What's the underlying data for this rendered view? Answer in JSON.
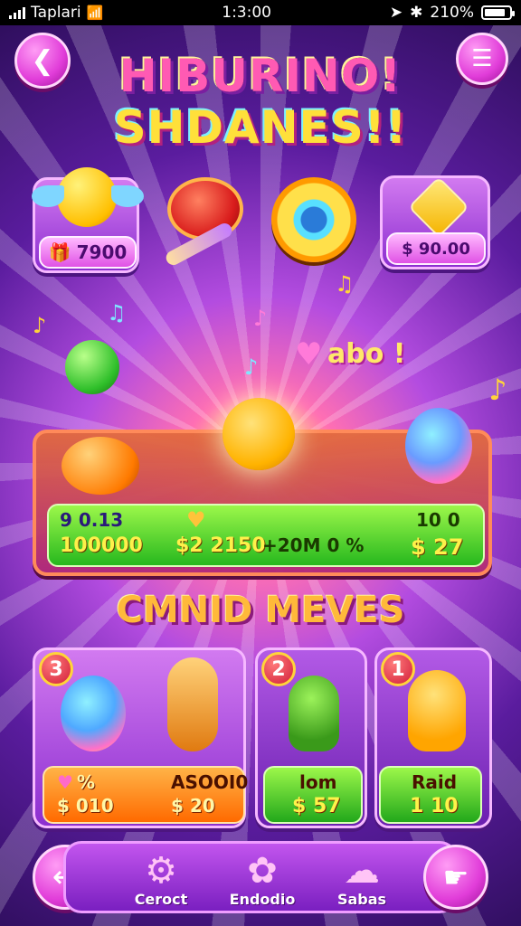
{
  "status_bar": {
    "carrier": "Taplari",
    "time": "1:3:00",
    "battery": "210%"
  },
  "header": {
    "back_icon": "back-arrow-icon",
    "menu_icon": "hamburger-menu-icon"
  },
  "title": {
    "line1": "HIBURINO!",
    "line2": "SHDANES!!"
  },
  "top_items": [
    {
      "icon": "emoji-wings-icon",
      "price": "7900"
    },
    {
      "icon": "drum-icon"
    },
    {
      "icon": "vinyl-record-icon"
    },
    {
      "icon": "music-note-diamond-icon",
      "price": "$ 90.00"
    }
  ],
  "floating_text": "abo !",
  "center_panel": {
    "stat_a": "9 0.13",
    "stat_b": "100000",
    "stat_c": "$2 2150",
    "stat_d": "+20M 0 %",
    "stat_e": "10 0",
    "stat_f": "$ 27"
  },
  "section_title": "CMNID MEVES",
  "moves": [
    {
      "badge": "3",
      "line1": "%",
      "line2": "$ 010"
    },
    {
      "badge": "",
      "line1": "ASOOI0",
      "line2": "$ 20"
    },
    {
      "badge": "2",
      "line1": "lom",
      "line2": "$ 57"
    },
    {
      "badge": "1",
      "line1": "Raid",
      "line2": "1 10"
    }
  ],
  "nav": {
    "left_icon": "back-undo-icon",
    "items": [
      {
        "icon": "gear-icon",
        "label": "Ceroct"
      },
      {
        "icon": "flower-gear-icon",
        "label": "Endodio"
      },
      {
        "icon": "cloud-icon",
        "label": "Sabas"
      }
    ],
    "right_icon": "hand-icon"
  },
  "colors": {
    "accent": "#e13dd9",
    "green": "#27b81e",
    "orange": "#ff6a00",
    "title_yellow": "#ffe03a"
  }
}
